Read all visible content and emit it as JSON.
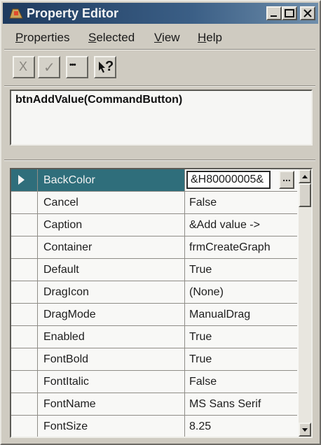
{
  "window": {
    "title": "Property Editor"
  },
  "menu": {
    "items": [
      {
        "label": "Properties",
        "mnemonic": "P",
        "rest": "roperties"
      },
      {
        "label": "Selected",
        "mnemonic": "S",
        "rest": "elected"
      },
      {
        "label": "View",
        "mnemonic": "V",
        "rest": "iew"
      },
      {
        "label": "Help",
        "mnemonic": "H",
        "rest": "elp"
      }
    ]
  },
  "toolbar": {
    "cancel_icon": "X",
    "ok_icon": "✓",
    "ellipsis_icon": "•••",
    "help_icon": "?"
  },
  "object": {
    "name": "btnAddValue(CommandButton)"
  },
  "properties": [
    {
      "name": "BackColor",
      "value": "&H80000005&",
      "selected": true
    },
    {
      "name": "Cancel",
      "value": "False"
    },
    {
      "name": "Caption",
      "value": "&Add value ->"
    },
    {
      "name": "Container",
      "value": "frmCreateGraph"
    },
    {
      "name": "Default",
      "value": "True"
    },
    {
      "name": "DragIcon",
      "value": "(None)"
    },
    {
      "name": "DragMode",
      "value": "ManualDrag"
    },
    {
      "name": "Enabled",
      "value": "True"
    },
    {
      "name": "FontBold",
      "value": "True"
    },
    {
      "name": "FontItalic",
      "value": "False"
    },
    {
      "name": "FontName",
      "value": "MS Sans Serif"
    },
    {
      "name": "FontSize",
      "value": "8.25"
    }
  ],
  "editor": {
    "ellipsis_label": "..."
  }
}
